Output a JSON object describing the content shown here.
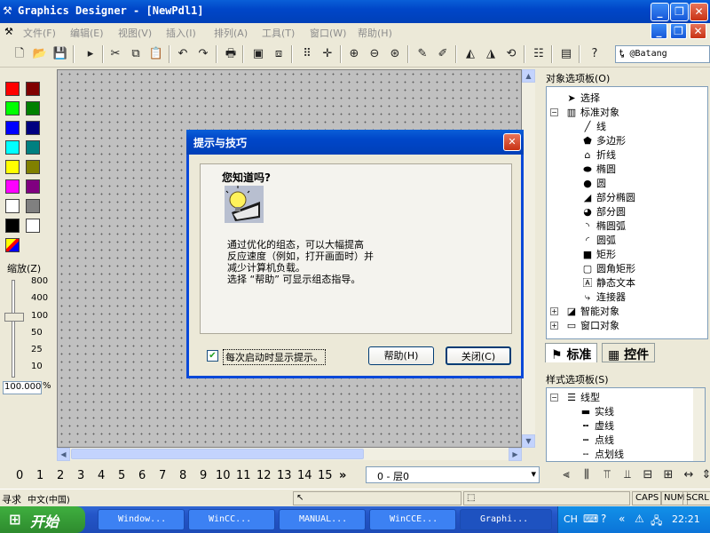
{
  "window": {
    "title": "Graphics Designer - [NewPdl1]"
  },
  "menu": [
    "文件(F)",
    "编辑(E)",
    "视图(V)",
    "插入(I)",
    "排列(A)",
    "工具(T)",
    "窗口(W)",
    "帮助(H)"
  ],
  "toolbar": {
    "buttons": [
      "new-icon",
      "open-icon",
      "save-icon",
      "run-icon",
      "cut-icon",
      "copy-icon",
      "paste-icon",
      "undo-icon",
      "redo-icon",
      "print-icon",
      "layer-icon",
      "group-icon",
      "grid-icon",
      "snap-icon",
      "zoom-in-icon",
      "zoom-out-icon",
      "zoom-fit-icon",
      "eyedropper-icon",
      "brush-icon",
      "flip-h-icon",
      "flip-v-icon",
      "rotate-icon",
      "properties-icon",
      "library-icon",
      "help-icon"
    ],
    "font": "@Batang"
  },
  "palette": {
    "colors": [
      "#FF0000",
      "#800000",
      "#00FF00",
      "#008000",
      "#0000FF",
      "#000080",
      "#00FFFF",
      "#008080",
      "#FFFF00",
      "#808000",
      "#FF00FF",
      "#800080",
      "#FFFFFF",
      "#808080",
      "#000000",
      "#FFFFFF"
    ]
  },
  "zoom": {
    "label": "缩放(Z)",
    "values": [
      "800",
      "400",
      "100",
      "50",
      "25",
      "10"
    ],
    "current": "100.000",
    "unit": "%"
  },
  "dialog": {
    "title": "提示与技巧",
    "heading": "您知道吗?",
    "body": "通过优化的组态，可以大幅提高\n反应速度（例如，打开画面时）并\n减少计算机负载。\n选择 “帮助” 可显示组态指导。",
    "checkbox_label": "每次启动时显示提示。",
    "checkbox_checked": true,
    "help_button": "帮助(H)",
    "close_button": "关闭(C)"
  },
  "object_palette": {
    "label": "对象选项板(O)",
    "items": [
      {
        "label": "选择",
        "icon": "arrow-icon"
      },
      {
        "label": "标准对象",
        "icon": "shapes-icon"
      },
      {
        "label": "线",
        "icon": "line-icon"
      },
      {
        "label": "多边形",
        "icon": "polygon-icon"
      },
      {
        "label": "折线",
        "icon": "polyline-icon"
      },
      {
        "label": "椭圆",
        "icon": "ellipse-icon"
      },
      {
        "label": "圆",
        "icon": "circle-icon"
      },
      {
        "label": "部分椭圆",
        "icon": "ellipse-segment-icon"
      },
      {
        "label": "部分圆",
        "icon": "pie-segment-icon"
      },
      {
        "label": "椭圆弧",
        "icon": "ellipse-arc-icon"
      },
      {
        "label": "圆弧",
        "icon": "arc-icon"
      },
      {
        "label": "矩形",
        "icon": "rectangle-icon"
      },
      {
        "label": "圆角矩形",
        "icon": "rounded-rect-icon"
      },
      {
        "label": "静态文本",
        "icon": "text-icon"
      },
      {
        "label": "连接器",
        "icon": "connector-icon"
      },
      {
        "label": "智能对象",
        "icon": "smart-object-icon"
      },
      {
        "label": "窗口对象",
        "icon": "window-object-icon"
      }
    ],
    "tabs": [
      "标准",
      "控件"
    ]
  },
  "style_palette": {
    "label": "样式选项板(S)",
    "items": [
      "线型",
      "实线",
      "虚线",
      "点线",
      "点划线"
    ]
  },
  "layers": {
    "numbers": [
      "0",
      "1",
      "2",
      "3",
      "4",
      "5",
      "6",
      "7",
      "8",
      "9",
      "10",
      "11",
      "12",
      "13",
      "14",
      "15"
    ],
    "more": "»",
    "selected": "0 - 层0"
  },
  "statusbar": {
    "left": "寻求",
    "lang": "中文(中国)",
    "caps": "CAPS",
    "num": "NUM",
    "scrl": "SCRL"
  },
  "taskbar": {
    "start": "开始",
    "tasks": [
      "Window...",
      "WinCC...",
      "MANUAL...",
      "WinCCE...",
      "Graphi..."
    ],
    "tray_lang": "CH",
    "time": "22:21"
  }
}
